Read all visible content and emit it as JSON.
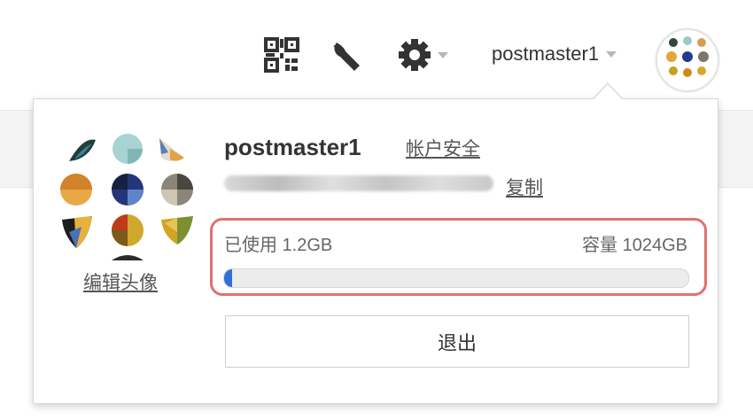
{
  "header": {
    "icons": [
      "qr-code-icon",
      "wrench-icon",
      "gear-icon"
    ],
    "username": "postmaster1"
  },
  "popup": {
    "username": "postmaster1",
    "account_security": "帐户安全",
    "copy": "复制",
    "edit_avatar": "编辑头像",
    "storage": {
      "used_label": "已使用 1.2GB",
      "capacity_label": "容量 1024GB",
      "used_fraction": 0.0012
    },
    "logout": "退出"
  },
  "colors": {
    "highlight_border": "#e07070",
    "progress_fill": "#2f6fd8"
  }
}
